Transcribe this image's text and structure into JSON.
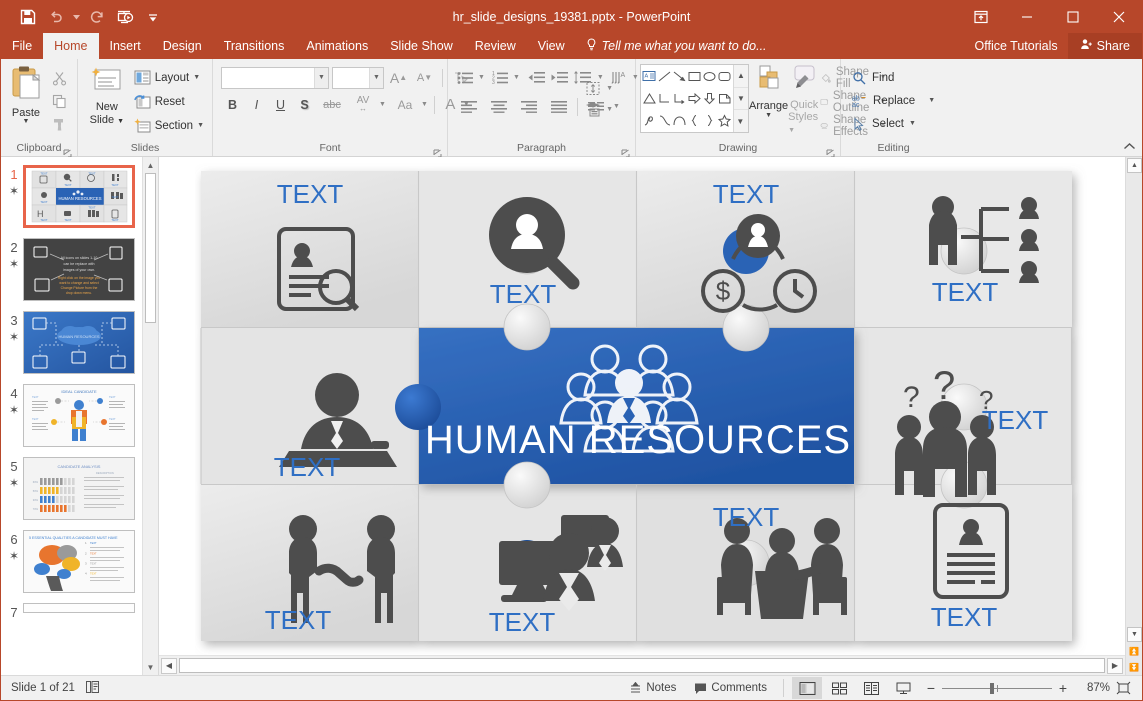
{
  "window": {
    "title": "hr_slide_designs_19381.pptx - PowerPoint",
    "quick_access": [
      {
        "name": "save-icon",
        "label": "Save"
      },
      {
        "name": "undo-icon",
        "label": "Undo"
      },
      {
        "name": "redo-icon",
        "label": "Redo"
      },
      {
        "name": "start-slideshow-icon",
        "label": "Start From Beginning"
      },
      {
        "name": "customize-qat-icon",
        "label": "Customize Quick Access Toolbar"
      }
    ],
    "controls": [
      {
        "name": "ribbon-display-options",
        "glyph": "ribbon"
      },
      {
        "name": "minimize",
        "glyph": "minimize"
      },
      {
        "name": "restore",
        "glyph": "restore"
      },
      {
        "name": "close",
        "glyph": "close"
      }
    ],
    "accent": "#b7472a",
    "tab_active_bg": "#f1f1f1"
  },
  "tabs": [
    {
      "label": "File",
      "active": false
    },
    {
      "label": "Home",
      "active": true
    },
    {
      "label": "Insert",
      "active": false
    },
    {
      "label": "Design",
      "active": false
    },
    {
      "label": "Transitions",
      "active": false
    },
    {
      "label": "Animations",
      "active": false
    },
    {
      "label": "Slide Show",
      "active": false
    },
    {
      "label": "Review",
      "active": false
    },
    {
      "label": "View",
      "active": false
    }
  ],
  "tellme": {
    "placeholder": "Tell me what you want to do..."
  },
  "account": {
    "office_tutorials": "Office Tutorials",
    "share": "Share"
  },
  "ribbon": {
    "groups": [
      {
        "label": "Clipboard"
      },
      {
        "label": "Slides"
      },
      {
        "label": "Font"
      },
      {
        "label": "Paragraph"
      },
      {
        "label": "Drawing"
      },
      {
        "label": "Editing"
      }
    ],
    "clipboard": {
      "paste_label": "Paste",
      "items": [
        {
          "name": "cut-icon",
          "label": "Cut"
        },
        {
          "name": "copy-icon",
          "label": "Copy"
        },
        {
          "name": "format-painter-icon",
          "label": "Format Painter"
        }
      ]
    },
    "slides": {
      "new_slide_line1": "New",
      "new_slide_line2": "Slide",
      "layout_label": "Layout",
      "reset_label": "Reset",
      "section_label": "Section"
    },
    "font": {
      "font_name_value": "",
      "font_size_value": "",
      "increase_size": "A",
      "decrease_size": "A",
      "clear_formatting": "Clear All Formatting",
      "bold": "B",
      "italic": "I",
      "underline": "U",
      "shadow": "S",
      "strikethrough": "abc",
      "char_spacing": "AV",
      "change_case": "Aa",
      "font_color": "A"
    },
    "paragraph": {
      "bullets": "Bullets",
      "numbering": "Numbering",
      "decrease_indent": "Decrease List Level",
      "increase_indent": "Increase List Level",
      "line_spacing": "Line Spacing",
      "text_direction": "Text Direction",
      "align_left": "Align Left",
      "align_center": "Center",
      "align_right": "Align Right",
      "justify": "Justify",
      "columns": "Columns",
      "align_text": "Align Text",
      "convert_smartart": "Convert to SmartArt"
    },
    "drawing": {
      "arrange_label": "Arrange",
      "quick_styles_line1": "Quick",
      "quick_styles_line2": "Styles",
      "shape_fill": "Shape Fill",
      "shape_outline": "Shape Outline",
      "shape_effects": "Shape Effects"
    },
    "editing": {
      "find": "Find",
      "replace": "Replace",
      "select": "Select"
    },
    "collapse_label": "Collapse the Ribbon"
  },
  "thumbnails": [
    {
      "number": "1",
      "selected": true,
      "kind": "puzzle",
      "title": "HUMAN RESOURCES"
    },
    {
      "number": "2",
      "selected": false,
      "kind": "dark-icons",
      "title": "All icons on slides 1-10 can be replace with images of your own. Right click on the image you want to change and select Change Picture from the drop down menu."
    },
    {
      "number": "3",
      "selected": false,
      "kind": "blue-cloud",
      "title": "HUMAN RESOURCES"
    },
    {
      "number": "4",
      "selected": false,
      "kind": "candidate",
      "title": "IDEAL CANDIDATE"
    },
    {
      "number": "5",
      "selected": false,
      "kind": "analysis",
      "title": "CANDIDATE ANALYSIS"
    },
    {
      "number": "6",
      "selected": false,
      "kind": "qualities",
      "title": "5 ESSENTIAL QUALITIES A CANDIDATE MUST HAVE"
    },
    {
      "number": "7",
      "selected": false,
      "kind": "partial",
      "title": ""
    }
  ],
  "slide": {
    "center_title": "HUMAN RESOURCES",
    "center_color": "#2a63b5",
    "label_color": "#2f6fc4",
    "pieces": [
      {
        "row": 0,
        "col": 0,
        "label": "TEXT",
        "label_pos": "top",
        "icon": "resume-search-icon"
      },
      {
        "row": 0,
        "col": 1,
        "label": "TEXT",
        "label_pos": "bottom",
        "icon": "person-magnifier-icon"
      },
      {
        "row": 0,
        "col": 2,
        "label": "TEXT",
        "label_pos": "top",
        "icon": "money-time-person-cycle-icon"
      },
      {
        "row": 0,
        "col": 3,
        "label": "TEXT",
        "label_pos": "bottom",
        "icon": "org-chart-icon"
      },
      {
        "row": 1,
        "col": 0,
        "label": "TEXT",
        "label_pos": "bottom",
        "icon": "person-desk-icon"
      },
      {
        "row": 1,
        "col": 3,
        "label": "TEXT",
        "label_pos": "right",
        "icon": "three-people-questions-icon"
      },
      {
        "row": 2,
        "col": 0,
        "label": "TEXT",
        "label_pos": "bottom",
        "icon": "handshake-icon"
      },
      {
        "row": 2,
        "col": 1,
        "label": "TEXT",
        "label_pos": "bottom",
        "icon": "training-screen-icon"
      },
      {
        "row": 2,
        "col": 2,
        "label": "TEXT",
        "label_pos": "top",
        "icon": "interview-panel-icon"
      },
      {
        "row": 2,
        "col": 3,
        "label": "TEXT",
        "label_pos": "bottom",
        "icon": "cv-document-icon"
      }
    ],
    "center_icon": "team-group-icon"
  },
  "statusbar": {
    "slide_indicator": "Slide 1 of 21",
    "accessibility_icon": "notes-page-icon",
    "notes": "Notes",
    "comments": "Comments",
    "views": [
      {
        "name": "normal-view",
        "active": true
      },
      {
        "name": "slide-sorter-view",
        "active": false
      },
      {
        "name": "reading-view",
        "active": false
      },
      {
        "name": "slideshow-view",
        "active": false
      }
    ],
    "zoom_out": "−",
    "zoom_in": "+",
    "zoom_value": "87%",
    "fit_to_window": "Fit slide to current window"
  }
}
